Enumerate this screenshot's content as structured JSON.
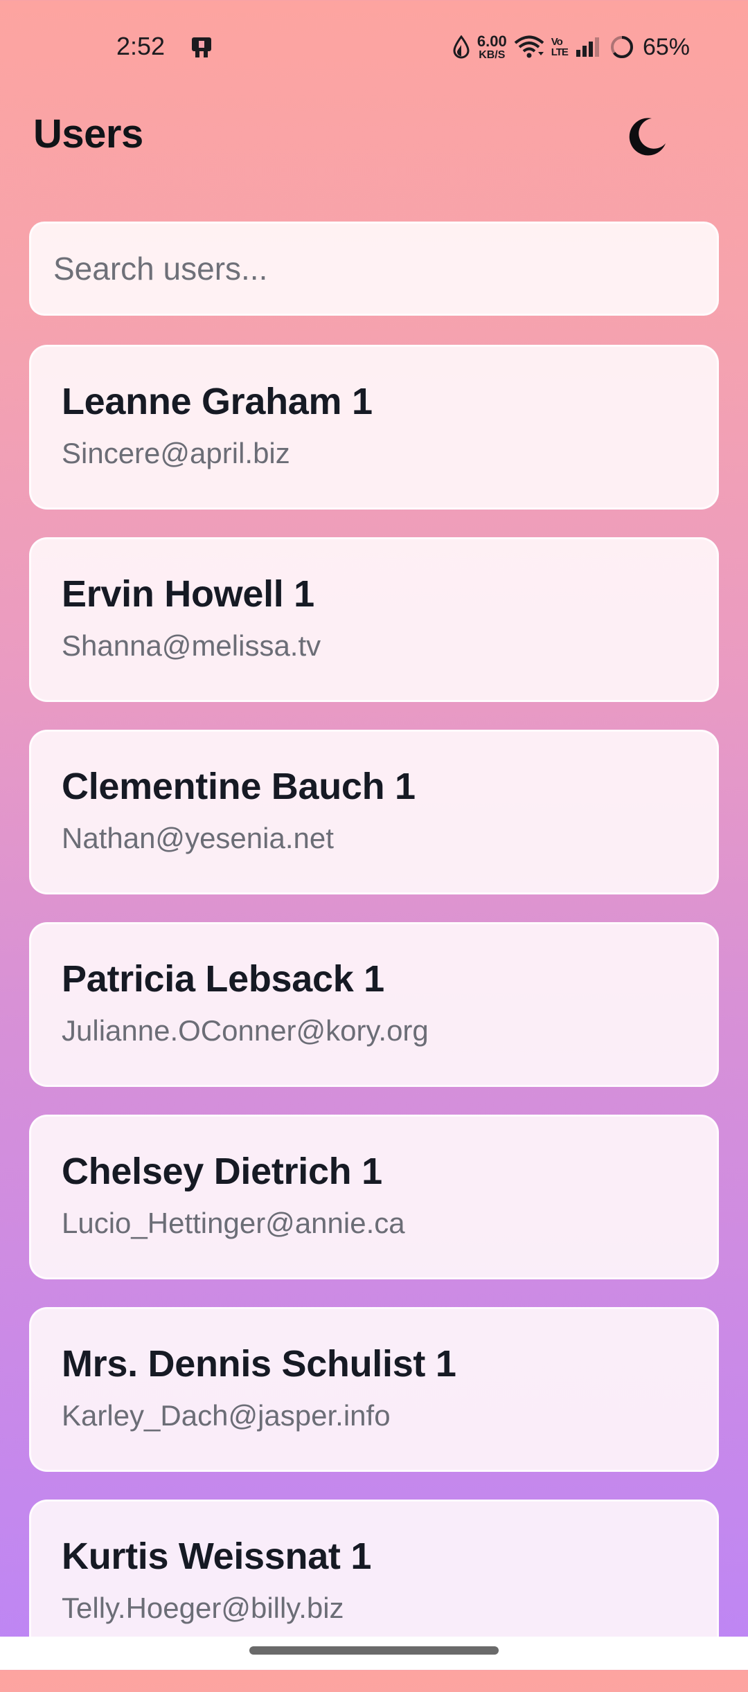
{
  "status_bar": {
    "time": "2:52",
    "net_speed_value": "6.00",
    "net_speed_unit": "KB/S",
    "volte_top": "Vo",
    "volte_bottom": "LTE",
    "battery_percent": "65%"
  },
  "header": {
    "title": "Users",
    "theme_toggle_icon": "moon-icon"
  },
  "search": {
    "placeholder": "Search users...",
    "value": ""
  },
  "users": [
    {
      "name": "Leanne Graham 1",
      "email": "Sincere@april.biz"
    },
    {
      "name": "Ervin Howell 1",
      "email": "Shanna@melissa.tv"
    },
    {
      "name": "Clementine Bauch 1",
      "email": "Nathan@yesenia.net"
    },
    {
      "name": "Patricia Lebsack 1",
      "email": "Julianne.OConner@kory.org"
    },
    {
      "name": "Chelsey Dietrich 1",
      "email": "Lucio_Hettinger@annie.ca"
    },
    {
      "name": "Mrs. Dennis Schulist 1",
      "email": "Karley_Dach@jasper.info"
    },
    {
      "name": "Kurtis Weissnat 1",
      "email": "Telly.Hoeger@billy.biz"
    }
  ],
  "colors": {
    "gradient_top": "#fda4a0",
    "gradient_bottom": "#bd86f5",
    "card_background": "#fff8fb",
    "title_text": "#101418",
    "email_text": "#6b6d76"
  }
}
